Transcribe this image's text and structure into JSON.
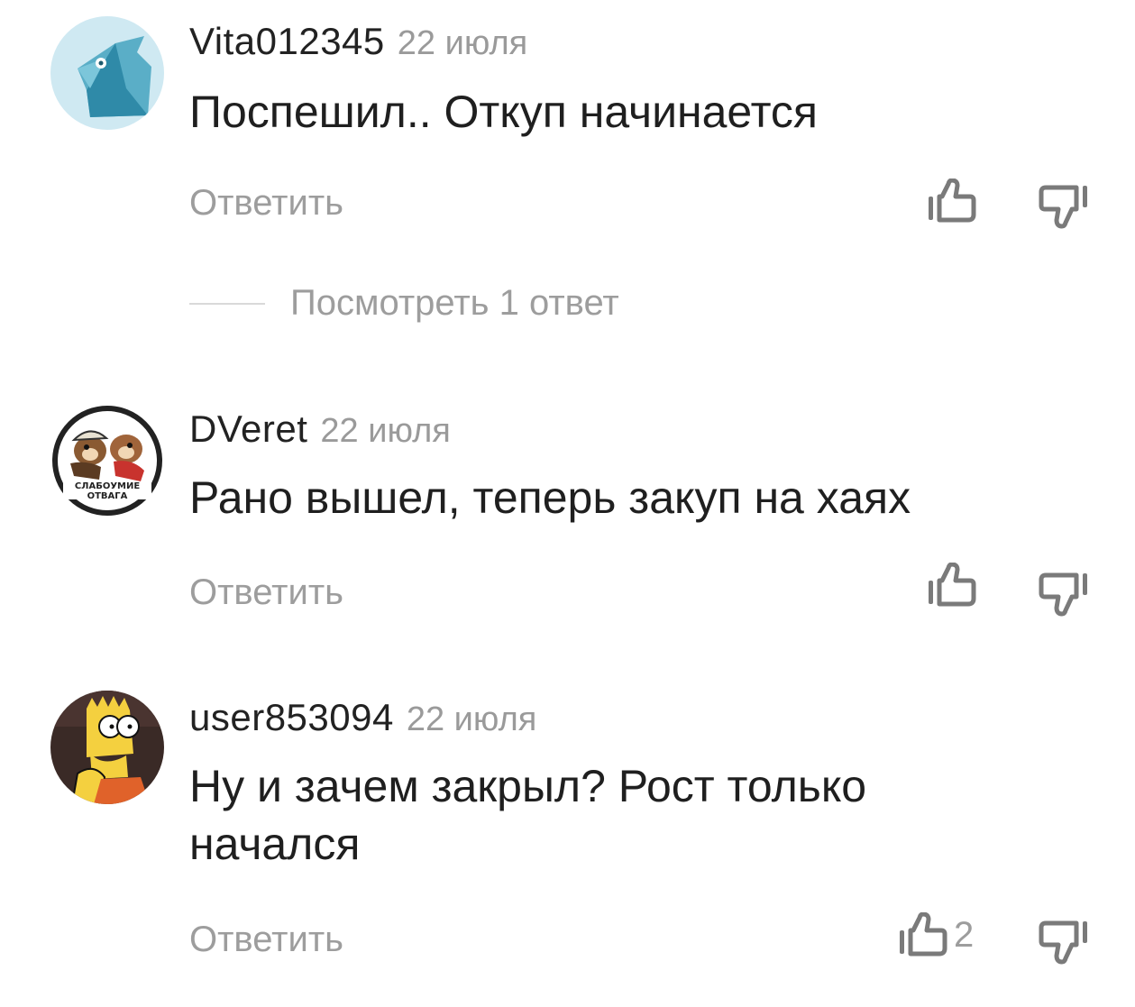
{
  "comments": [
    {
      "author": "Vita012345",
      "date": "22 июля",
      "text": "Поспешил.. Откуп начинается",
      "reply_label": "Ответить",
      "likes": "",
      "view_replies_label": "Посмотреть 1 ответ",
      "avatar_icon": "blue-bird-icon"
    },
    {
      "author": "DVeret",
      "date": "22 июля",
      "text": "Рано вышел, теперь закуп на хаях",
      "reply_label": "Ответить",
      "likes": "",
      "avatar_icon": "chip-and-dale-icon",
      "avatar_caption_1": "СЛАБОУМИЕ",
      "avatar_caption_2": "ОТВАГА"
    },
    {
      "author": "user853094",
      "date": "22 июля",
      "text": "Ну и зачем закрыл? Рост только начался",
      "reply_label": "Ответить",
      "likes": "2",
      "avatar_icon": "bart-simpson-icon"
    }
  ],
  "colors": {
    "muted": "#9d9d9d",
    "text": "#1f1f1f",
    "icon": "#7a7a7a"
  }
}
